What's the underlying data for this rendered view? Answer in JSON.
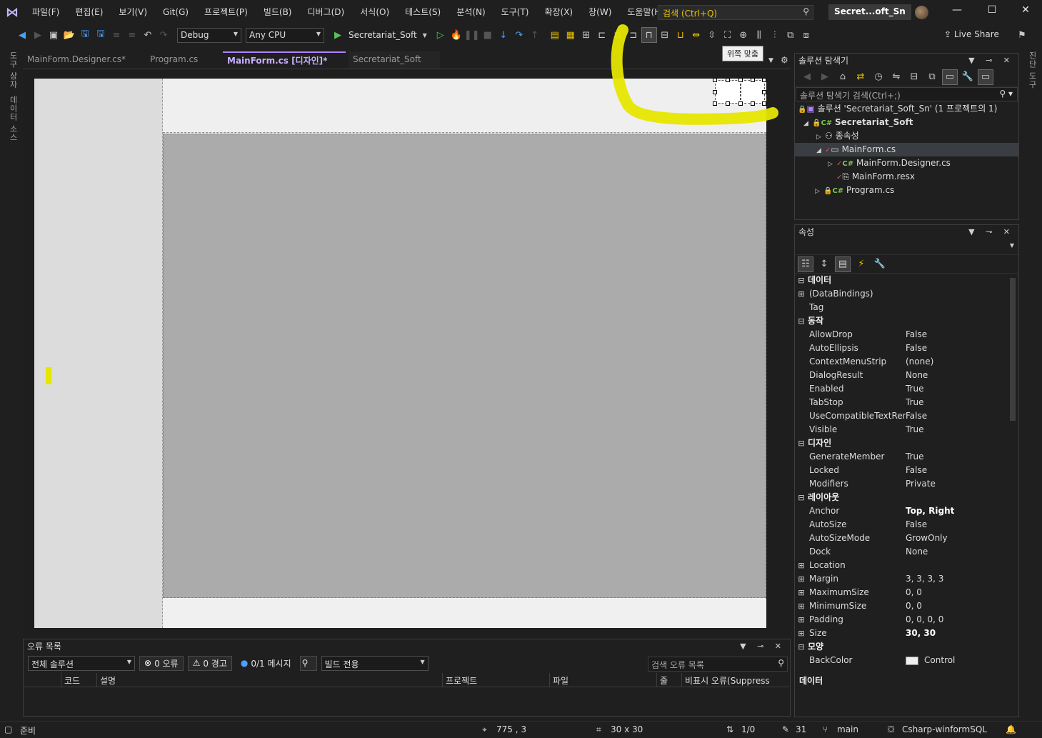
{
  "menubar": {
    "items": [
      "파일(F)",
      "편집(E)",
      "보기(V)",
      "Git(G)",
      "프로젝트(P)",
      "빌드(B)",
      "디버그(D)",
      "서식(O)",
      "테스트(S)",
      "분석(N)",
      "도구(T)",
      "확장(X)",
      "창(W)",
      "도움말(H)"
    ],
    "search_placeholder": "검색 (Ctrl+Q)",
    "solution_badge": "Secret...oft_Sn"
  },
  "toolbar": {
    "config": "Debug",
    "platform": "Any CPU",
    "run_target": "Secretariat_Soft",
    "live_share": "Live Share",
    "tooltip": "위쪽 맞춤"
  },
  "left_strip": {
    "toolbox": "도구 상자",
    "datasource": "데이터 소스"
  },
  "right_strip": {
    "diagnostics": "진단 도구"
  },
  "doc_tabs": [
    {
      "label": "MainForm.Designer.cs*"
    },
    {
      "label": "Program.cs"
    },
    {
      "label": "MainForm.cs [디자인]*"
    },
    {
      "label": "Secretariat_Soft"
    }
  ],
  "error_list": {
    "title": "오류 목록",
    "scope": "전체 솔루션",
    "errors": "0 오류",
    "warnings": "0 경고",
    "messages": "0/1 메시지",
    "build_filter": "빌드 전용",
    "search_placeholder": "검색 오류 목록",
    "columns": [
      "코드",
      "설명",
      "프로젝트",
      "파일",
      "줄",
      "비표시 오류(Suppress"
    ]
  },
  "solution_explorer": {
    "title": "솔루션 탐색기",
    "search_placeholder": "솔루션 탐색기 검색(Ctrl+;)",
    "tree": [
      {
        "label": "솔루션 'Secretariat_Soft_Sn' (1 프로젝트의 1)"
      },
      {
        "label": "Secretariat_Soft"
      },
      {
        "label": "종속성"
      },
      {
        "label": "MainForm.cs"
      },
      {
        "label": "MainForm.Designer.cs"
      },
      {
        "label": "MainForm.resx"
      },
      {
        "label": "Program.cs"
      }
    ]
  },
  "properties": {
    "title": "속성",
    "rows": [
      {
        "kind": "cat",
        "name": "데이터",
        "value": ""
      },
      {
        "kind": "exp",
        "name": "(DataBindings)",
        "value": ""
      },
      {
        "kind": "prop",
        "name": "Tag",
        "value": ""
      },
      {
        "kind": "cat",
        "name": "동작",
        "value": ""
      },
      {
        "kind": "prop",
        "name": "AllowDrop",
        "value": "False"
      },
      {
        "kind": "prop",
        "name": "AutoEllipsis",
        "value": "False"
      },
      {
        "kind": "prop",
        "name": "ContextMenuStrip",
        "value": "(none)"
      },
      {
        "kind": "prop",
        "name": "DialogResult",
        "value": "None"
      },
      {
        "kind": "prop",
        "name": "Enabled",
        "value": "True"
      },
      {
        "kind": "prop",
        "name": "TabStop",
        "value": "True"
      },
      {
        "kind": "prop",
        "name": "UseCompatibleTextRendering",
        "value": "False"
      },
      {
        "kind": "prop",
        "name": "Visible",
        "value": "True"
      },
      {
        "kind": "cat",
        "name": "디자인",
        "value": ""
      },
      {
        "kind": "prop",
        "name": "GenerateMember",
        "value": "True"
      },
      {
        "kind": "prop",
        "name": "Locked",
        "value": "False"
      },
      {
        "kind": "prop",
        "name": "Modifiers",
        "value": "Private"
      },
      {
        "kind": "cat",
        "name": "레이아웃",
        "value": ""
      },
      {
        "kind": "prop",
        "name": "Anchor",
        "value": "Top, Right",
        "bold": true
      },
      {
        "kind": "prop",
        "name": "AutoSize",
        "value": "False"
      },
      {
        "kind": "prop",
        "name": "AutoSizeMode",
        "value": "GrowOnly"
      },
      {
        "kind": "prop",
        "name": "Dock",
        "value": "None"
      },
      {
        "kind": "exp",
        "name": "Location",
        "value": ""
      },
      {
        "kind": "exp",
        "name": "Margin",
        "value": "3, 3, 3, 3"
      },
      {
        "kind": "exp",
        "name": "MaximumSize",
        "value": "0, 0"
      },
      {
        "kind": "exp",
        "name": "MinimumSize",
        "value": "0, 0"
      },
      {
        "kind": "exp",
        "name": "Padding",
        "value": "0, 0, 0, 0"
      },
      {
        "kind": "exp",
        "name": "Size",
        "value": "30, 30",
        "bold": true
      },
      {
        "kind": "cat",
        "name": "모양",
        "value": ""
      },
      {
        "kind": "swatch",
        "name": "BackColor",
        "value": "Control"
      }
    ],
    "footer": "데이터"
  },
  "status": {
    "ready": "준비",
    "position": "775 , 3",
    "size": "30 x 30",
    "sync": "1/0",
    "edits": "31",
    "branch": "main",
    "repo": "Csharp-winformSQL"
  },
  "colors": {
    "accent": "#b180ff",
    "annotation": "#e6e600",
    "designer_gray": "#ababab"
  }
}
